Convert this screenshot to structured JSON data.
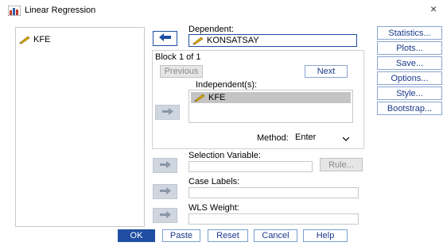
{
  "window": {
    "title": "Linear Regression",
    "close_glyph": "×"
  },
  "variable_list": {
    "items": [
      {
        "label": "KFE",
        "icon": "ruler-pencil-icon"
      }
    ]
  },
  "dependent": {
    "label": "Dependent:",
    "value": "KONSATSAY",
    "icon": "ruler-pencil-icon"
  },
  "block": {
    "label": "Block 1 of 1",
    "previous": "Previous",
    "next": "Next"
  },
  "independents": {
    "label": "Independent(s):",
    "items": [
      {
        "label": "KFE",
        "icon": "ruler-pencil-icon"
      }
    ]
  },
  "method": {
    "label": "Method:",
    "value": "Enter"
  },
  "selection_variable": {
    "label": "Selection Variable:",
    "value": "",
    "rule_button": "Rule..."
  },
  "case_labels": {
    "label": "Case Labels:",
    "value": ""
  },
  "wls_weight": {
    "label": "WLS Weight:",
    "value": ""
  },
  "side_buttons": [
    "Statistics...",
    "Plots...",
    "Save...",
    "Options...",
    "Style...",
    "Bootstrap..."
  ],
  "bottom_buttons": {
    "ok": "OK",
    "paste": "Paste",
    "reset": "Reset",
    "cancel": "Cancel",
    "help": "Help"
  },
  "colors": {
    "accent": "#1f4ea3",
    "selection": "#c4c4c4",
    "arrow_disabled": "#cfd6df"
  }
}
